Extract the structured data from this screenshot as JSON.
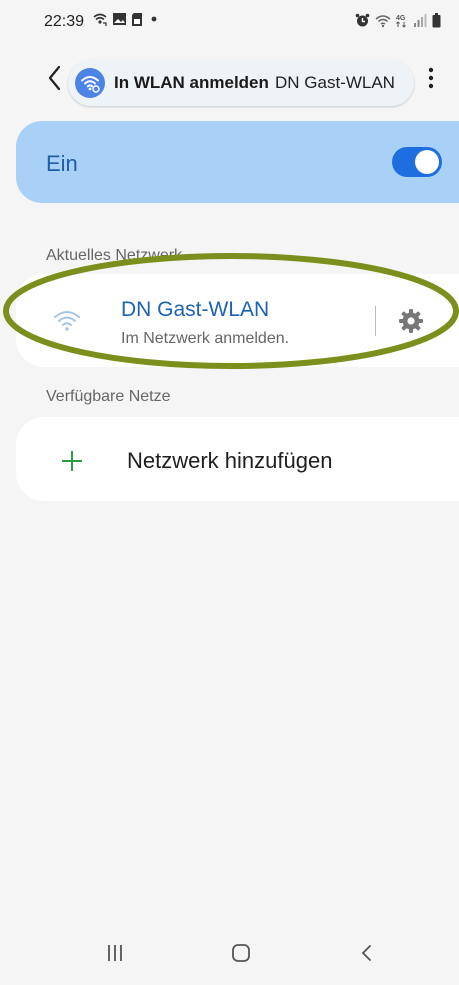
{
  "status_bar": {
    "time": "22:39",
    "left_icons": [
      "wifi-calling-icon",
      "image-icon",
      "sim-icon",
      "dot-icon"
    ],
    "right_icons": [
      "alarm-icon",
      "wifi-icon",
      "lte-4g-icon",
      "signal-icon",
      "battery-icon"
    ]
  },
  "header": {
    "back_icon": "chevron-left-icon",
    "title": "In WLAN anmelden",
    "network_name": "DN Gast-WLAN",
    "menu_icon": "more-vert-icon"
  },
  "toggle": {
    "label": "Ein",
    "state": "on",
    "accent": "#1f6ee0"
  },
  "current_network": {
    "section_title": "Aktuelles Netzwerk",
    "name": "DN Gast-WLAN",
    "subtitle": "Im Netzwerk anmelden.",
    "icon": "wifi-icon",
    "settings_icon": "gear-icon"
  },
  "available_networks": {
    "section_title": "Verfügbare Netze",
    "add_label": "Netzwerk hinzufügen",
    "add_icon": "plus-icon"
  },
  "nav_bar": {
    "recent_icon": "recent-apps-icon",
    "home_icon": "home-icon",
    "back_icon": "back-icon"
  },
  "highlight_color": "#7a8f1c"
}
